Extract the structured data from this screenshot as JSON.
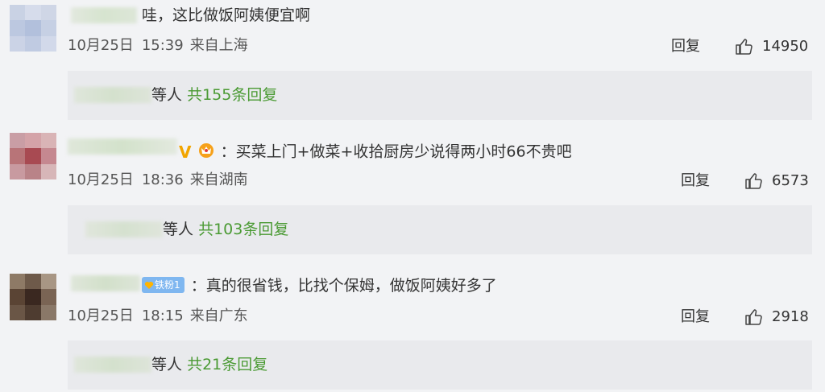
{
  "comments": [
    {
      "text": "哇，这比做饭阿姨便宜啊",
      "date": "10月25日",
      "time": "15:39",
      "location": "来自上海",
      "reply_label": "回复",
      "likes": "14950",
      "replies": {
        "suffix": "等人",
        "count": "共155条回复"
      }
    },
    {
      "text": "：买菜上门+做菜+收拾厨房少说得两小时66不贵吧",
      "date": "10月25日",
      "time": "18:36",
      "location": "来自湖南",
      "reply_label": "回复",
      "likes": "6573",
      "replies": {
        "suffix": "等人",
        "count": "共103条回复"
      }
    },
    {
      "text": "：真的很省钱，比找个保姆，做饭阿姨好多了",
      "badge": "铁粉1",
      "date": "10月25日",
      "time": "18:15",
      "location": "来自广东",
      "reply_label": "回复",
      "likes": "2918",
      "replies": {
        "suffix": "等人",
        "count": "共21条回复"
      }
    }
  ],
  "colors": {
    "reply_count": "#4a9a33",
    "background": "#f2f3f5",
    "reply_box": "#e9eaed"
  }
}
